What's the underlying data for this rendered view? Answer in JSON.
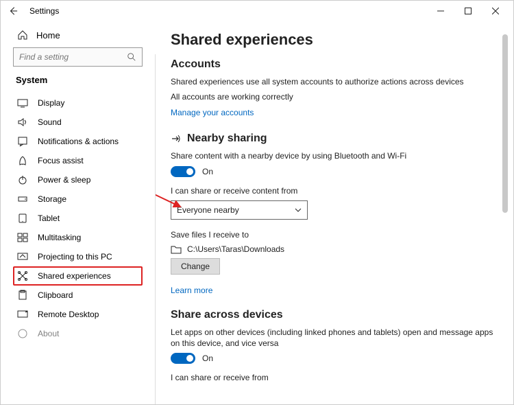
{
  "titlebar": {
    "title": "Settings"
  },
  "sidebar": {
    "home_label": "Home",
    "search_placeholder": "Find a setting",
    "section_title": "System",
    "items": [
      {
        "label": "Display"
      },
      {
        "label": "Sound"
      },
      {
        "label": "Notifications & actions"
      },
      {
        "label": "Focus assist"
      },
      {
        "label": "Power & sleep"
      },
      {
        "label": "Storage"
      },
      {
        "label": "Tablet"
      },
      {
        "label": "Multitasking"
      },
      {
        "label": "Projecting to this PC"
      },
      {
        "label": "Shared experiences"
      },
      {
        "label": "Clipboard"
      },
      {
        "label": "Remote Desktop"
      },
      {
        "label": "About"
      }
    ]
  },
  "content": {
    "page_title": "Shared experiences",
    "accounts": {
      "heading": "Accounts",
      "desc": "Shared experiences use all system accounts to authorize actions across devices",
      "status": "All accounts are working correctly",
      "manage_link": "Manage your accounts"
    },
    "nearby": {
      "heading": "Nearby sharing",
      "desc": "Share content with a nearby device by using Bluetooth and Wi-Fi",
      "toggle_state": "On",
      "share_from_label": "I can share or receive content from",
      "share_from_value": "Everyone nearby",
      "save_to_label": "Save files I receive to",
      "save_to_path": "C:\\Users\\Taras\\Downloads",
      "change_btn": "Change",
      "learn_more": "Learn more"
    },
    "across": {
      "heading": "Share across devices",
      "desc": "Let apps on other devices (including linked phones and tablets) open and message apps on this device, and vice versa",
      "toggle_state": "On",
      "share_from_label": "I can share or receive from"
    }
  }
}
